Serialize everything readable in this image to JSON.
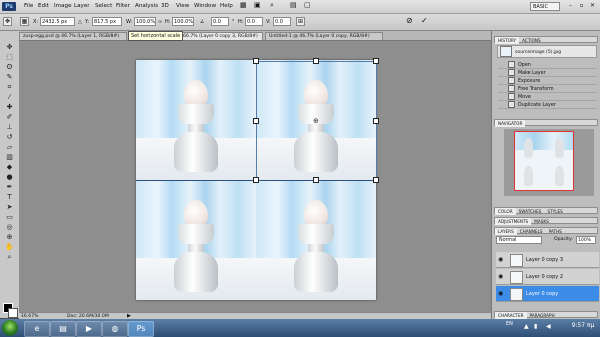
{
  "app": {
    "logo": "Ps",
    "workspace": "BASIC"
  },
  "menu": [
    "File",
    "Edit",
    "Image",
    "Layer",
    "Select",
    "Filter",
    "Analysis",
    "3D",
    "View",
    "Window",
    "Help"
  ],
  "options": {
    "x_value": "2432.5 px",
    "y_value": "817.5 px",
    "w_label": "W:",
    "w_value": "100.0%",
    "h_value": "100.0%",
    "angle_value": "0.0",
    "h_skew_label": "H:",
    "h_skew_value": "0.0",
    "v_skew_label": "V:",
    "v_skew_value": "0.0"
  },
  "tooltip": "Set horizontal scale",
  "tabs": [
    {
      "label": "zusp-egg.psd @ 46.7% (Layer 1, RGB/8#)"
    },
    {
      "label": "@ 66.7% (Layer 0 copy 3, RGB/8#)"
    },
    {
      "label": "Untitled-1 @ 46.7% (Layer 0 copy, RGB/8#)"
    }
  ],
  "status": {
    "zoom": "16.67%",
    "doc": "Doc: 20.6M/30.0M"
  },
  "history": {
    "tabs": [
      "HISTORY",
      "ACTIONS"
    ],
    "snapshot": "sourceimage (5).jpg",
    "items": [
      "Open",
      "Make Layer",
      "Exposure",
      "Free Transform",
      "Move",
      "Duplicate Layer"
    ]
  },
  "navigator": {
    "tab": "NAVIGATOR"
  },
  "color_tabs": [
    "COLOR",
    "SWATCHES",
    "STYLES"
  ],
  "adjust_tabs": [
    "ADJUSTMENTS",
    "MASKS"
  ],
  "layers": {
    "tabs": [
      "LAYERS",
      "CHANNELS",
      "PATHS"
    ],
    "blend_mode": "Normal",
    "opacity_label": "Opacity:",
    "opacity": "100%",
    "items": [
      {
        "name": "Layer 0 copy 3",
        "selected": false
      },
      {
        "name": "Layer 0 copy 2",
        "selected": false
      },
      {
        "name": "Layer 0 copy",
        "selected": true
      }
    ]
  },
  "bottom_tabs": [
    "CHARACTER",
    "PARAGRAPH"
  ],
  "taskbar": {
    "lang": "EN",
    "time": "9:57 πμ"
  },
  "colors": {
    "accent": "#3c8be6",
    "taskbar": "#2d4e75"
  }
}
